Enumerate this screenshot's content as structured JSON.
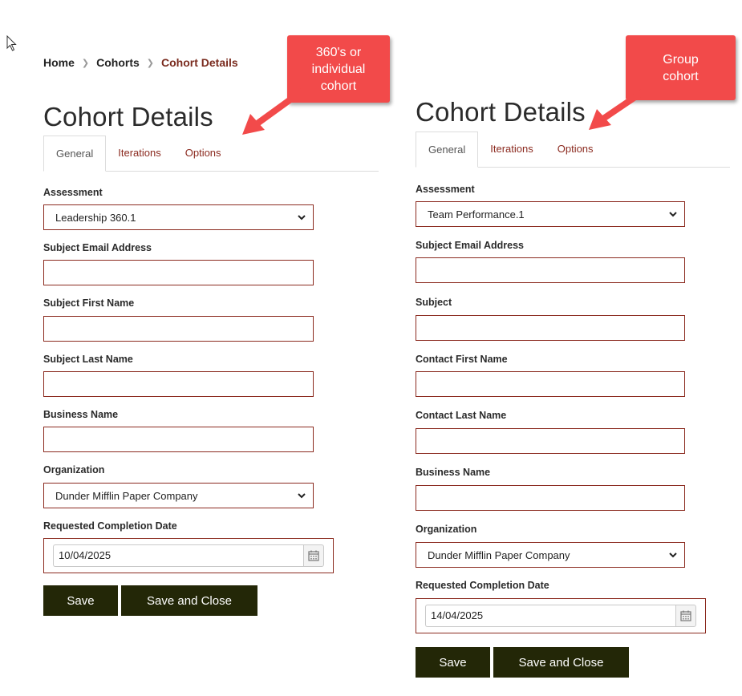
{
  "breadcrumb": {
    "home": "Home",
    "cohorts": "Cohorts",
    "current": "Cohort Details"
  },
  "callouts": {
    "individual": "360's or individual cohort",
    "group": "Group cohort"
  },
  "left_form": {
    "title": "Cohort Details",
    "tabs": [
      "General",
      "Iterations",
      "Options"
    ],
    "assessment_label": "Assessment",
    "assessment_value": "Leadership 360.1",
    "subject_email_label": "Subject Email Address",
    "subject_first_label": "Subject First Name",
    "subject_last_label": "Subject Last Name",
    "business_label": "Business Name",
    "organization_label": "Organization",
    "organization_value": "Dunder Mifflin Paper Company",
    "completion_label": "Requested Completion Date",
    "completion_value": "10/04/2025",
    "save_label": "Save",
    "save_close_label": "Save and Close"
  },
  "right_form": {
    "title": "Cohort Details",
    "tabs": [
      "General",
      "Iterations",
      "Options"
    ],
    "assessment_label": "Assessment",
    "assessment_value": "Team Performance.1",
    "subject_email_label": "Subject Email Address",
    "subject_label": "Subject",
    "contact_first_label": "Contact First Name",
    "contact_last_label": "Contact Last Name",
    "business_label": "Business Name",
    "organization_label": "Organization",
    "organization_value": "Dunder Mifflin Paper Company",
    "completion_label": "Requested Completion Date",
    "completion_value": "14/04/2025",
    "save_label": "Save",
    "save_close_label": "Save and Close"
  },
  "icons": {
    "cursor": "mouse-pointer-icon",
    "dropdown": "chevron-down-icon",
    "calendar": "calendar-icon"
  },
  "colors": {
    "accent": "#8b2a1f",
    "button": "#232707",
    "callout": "#f24a4a"
  }
}
